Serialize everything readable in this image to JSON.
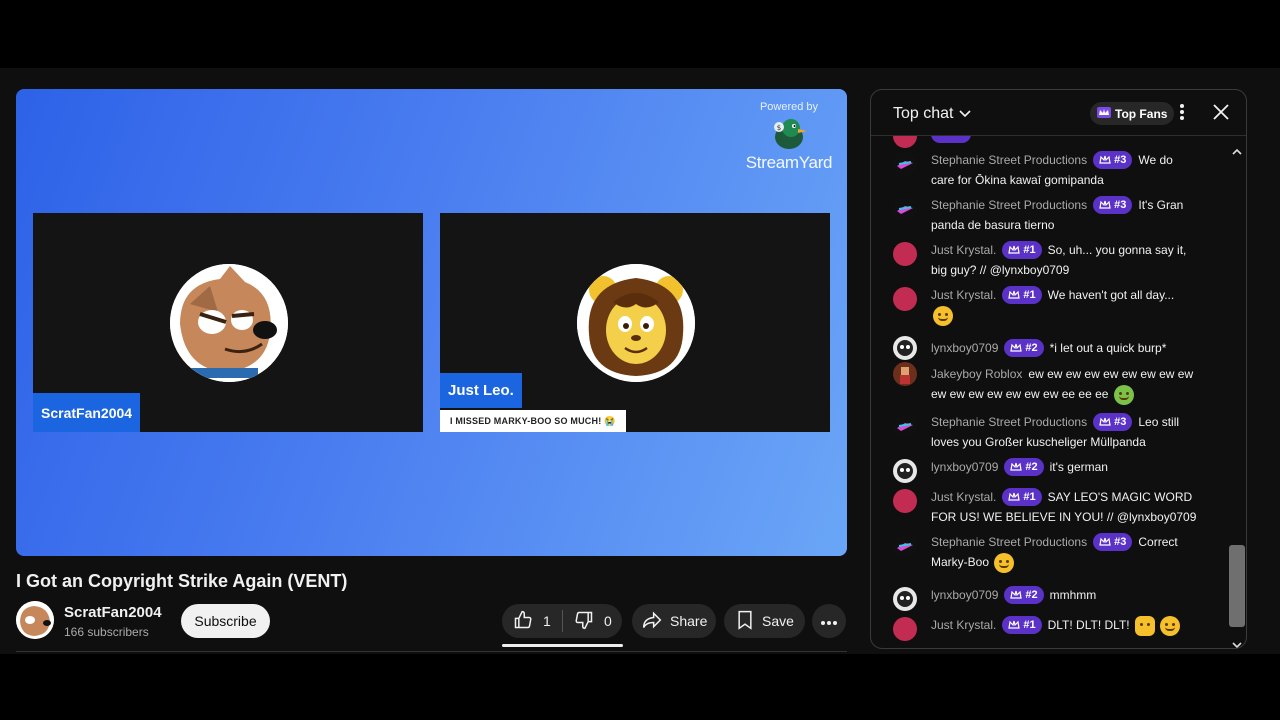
{
  "video": {
    "powered_by": "Powered by",
    "brand": "StreamYard",
    "participants": [
      {
        "name": "ScratFan2004"
      },
      {
        "name": "Just Leo.",
        "banner": "I MISSED MARKY-BOO SO MUCH! 😭"
      }
    ],
    "title": "I Got an Copyright Strike Again (VENT)"
  },
  "channel": {
    "name": "ScratFan2004",
    "subscribers": "166 subscribers",
    "subscribe_label": "Subscribe"
  },
  "actions": {
    "likes": "1",
    "dislikes": "0",
    "share_label": "Share",
    "save_label": "Save"
  },
  "chat": {
    "header": "Top chat",
    "top_fans_label": "Top Fans",
    "messages": [
      {
        "author": "Stephanie Street Productions",
        "badge": "#3",
        "text": "We do care for Ōkina kawaī gomipanda"
      },
      {
        "author": "Stephanie Street Productions",
        "badge": "#3",
        "text": "It's Gran panda de basura tierno"
      },
      {
        "author": "Just Krystal.",
        "badge": "#1",
        "text": "So, uh... you gonna say it, big guy? // @lynxboy0709"
      },
      {
        "author": "Just Krystal.",
        "badge": "#1",
        "text": "We haven't got all day..."
      },
      {
        "author": "lynxboy0709",
        "badge": "#2",
        "text": "*i let out a quick burp*"
      },
      {
        "author": "Jakeyboy Roblox",
        "badge": "",
        "text": "ew ew ew ew ew ew ew ew ew ew ew ew ew ew ew ew ee ee ee"
      },
      {
        "author": "Stephanie Street Productions",
        "badge": "#3",
        "text": "Leo still loves you Großer kuscheliger Müllpanda"
      },
      {
        "author": "lynxboy0709",
        "badge": "#2",
        "text": "it's german"
      },
      {
        "author": "Just Krystal.",
        "badge": "#1",
        "text": "SAY LEO'S MAGIC WORD FOR US! WE BELIEVE IN YOU! // @lynxboy0709"
      },
      {
        "author": "Stephanie Street Productions",
        "badge": "#3",
        "text": "Correct Marky-Boo"
      },
      {
        "author": "lynxboy0709",
        "badge": "#2",
        "text": "mmhmm"
      },
      {
        "author": "Just Krystal.",
        "badge": "#1",
        "text": "DLT! DLT! DLT!"
      }
    ]
  }
}
